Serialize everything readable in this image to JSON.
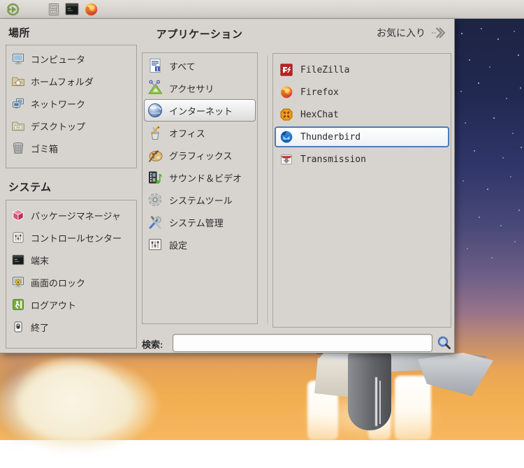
{
  "colors": {
    "menu_bg": "#d7d4cf",
    "panel_bg": "#d9d6d1",
    "selection_border": "#4a7cb8",
    "selection_bg": "#ffffff",
    "box_border": "#a5a29c",
    "sky_top": "#1b2240",
    "sky_bottom_orange": "#f2ae51"
  },
  "panel": {
    "launchers": [
      {
        "icon": "mint-menu-icon"
      },
      {
        "icon": "file-manager-icon"
      },
      {
        "icon": "terminal-launcher-icon"
      },
      {
        "icon": "firefox-launcher-icon"
      }
    ]
  },
  "places": {
    "header": "場所",
    "items": [
      {
        "label": "コンピュータ",
        "icon": "computer-icon"
      },
      {
        "label": "ホームフォルダ",
        "icon": "home-folder-icon"
      },
      {
        "label": "ネットワーク",
        "icon": "network-icon"
      },
      {
        "label": "デスクトップ",
        "icon": "desktop-icon"
      },
      {
        "label": "ゴミ箱",
        "icon": "trash-icon"
      }
    ]
  },
  "system": {
    "header": "システム",
    "items": [
      {
        "label": "パッケージマネージャ",
        "icon": "package-manager-icon"
      },
      {
        "label": "コントロールセンター",
        "icon": "control-center-icon"
      },
      {
        "label": "端末",
        "icon": "terminal-icon"
      },
      {
        "label": "画面のロック",
        "icon": "screen-lock-icon"
      },
      {
        "label": "ログアウト",
        "icon": "logout-icon"
      },
      {
        "label": "終了",
        "icon": "quit-icon"
      }
    ]
  },
  "applications": {
    "header": "アプリケーション",
    "favorites_label": "お気に入り",
    "categories": [
      {
        "label": "すべて",
        "icon": "all-icon",
        "selected": false
      },
      {
        "label": "アクセサリ",
        "icon": "accessories-icon",
        "selected": false
      },
      {
        "label": "インターネット",
        "icon": "internet-icon",
        "selected": true
      },
      {
        "label": "オフィス",
        "icon": "office-icon",
        "selected": false
      },
      {
        "label": "グラフィックス",
        "icon": "graphics-icon",
        "selected": false
      },
      {
        "label": "サウンド＆ビデオ",
        "icon": "sound-video-icon",
        "selected": false
      },
      {
        "label": "システムツール",
        "icon": "system-tools-icon",
        "selected": false
      },
      {
        "label": "システム管理",
        "icon": "system-admin-icon",
        "selected": false
      },
      {
        "label": "設定",
        "icon": "settings-icon",
        "selected": false
      }
    ],
    "apps": [
      {
        "label": "FileZilla",
        "icon": "filezilla-icon",
        "selected": false
      },
      {
        "label": "Firefox",
        "icon": "firefox-icon",
        "selected": false
      },
      {
        "label": "HexChat",
        "icon": "hexchat-icon",
        "selected": false
      },
      {
        "label": "Thunderbird",
        "icon": "thunderbird-icon",
        "selected": true
      },
      {
        "label": "Transmission",
        "icon": "transmission-icon",
        "selected": false
      }
    ]
  },
  "search": {
    "label": "検索:",
    "value": ""
  }
}
